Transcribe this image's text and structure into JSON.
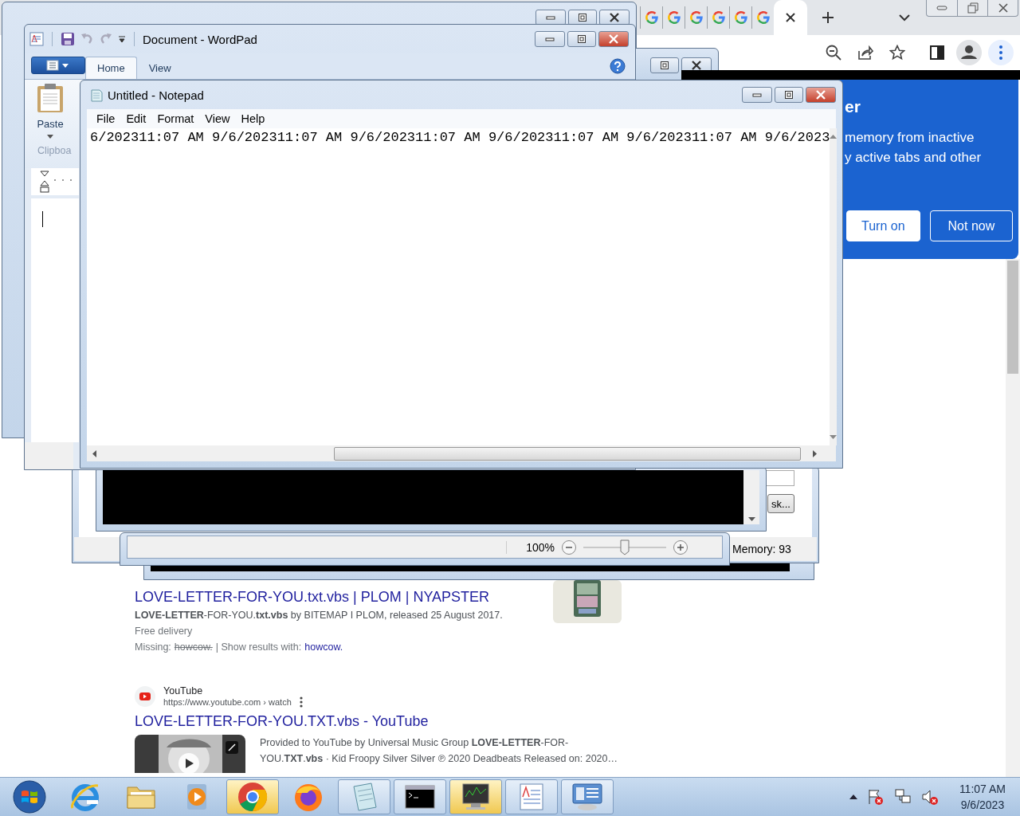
{
  "browser": {
    "tabs": [
      {
        "kind": "google",
        "selected": false
      },
      {
        "kind": "google",
        "selected": false
      },
      {
        "kind": "google",
        "selected": false
      },
      {
        "kind": "google",
        "selected": false
      },
      {
        "kind": "google",
        "selected": false
      },
      {
        "kind": "google",
        "selected": false
      },
      {
        "kind": "blank",
        "selected": true
      }
    ],
    "promo": {
      "title": "er",
      "lines": [
        "memory from inactive",
        "y active tabs and other"
      ],
      "buttons": [
        "Turn on",
        "Not now"
      ]
    },
    "results": [
      {
        "kind": "product",
        "title": "LOVE-LETTER-FOR-YOU.txt.vbs | PLOM | NYAPSTER",
        "snippet": "**LOVE-LETTER**-FOR-YOU.**txt.vbs** by BITEMAP I PLOM, released 25 August 2017.",
        "extra": "Free delivery",
        "missing_label": "Missing:",
        "missing_term": "howcow.",
        "show_label": "| Show results with:",
        "show_link": "howcow."
      },
      {
        "kind": "video",
        "source": "YouTube",
        "url": "https://www.youtube.com › watch",
        "title": "LOVE-LETTER-FOR-YOU.TXT.vbs - YouTube",
        "snippet": "Provided to YouTube by Universal Music Group **LOVE-LETTER**-FOR-YOU.**TXT**.**vbs** · Kid Froopy Silver Silver ℗ 2020 Deadbeats Released on: 2020…"
      }
    ]
  },
  "wordpad": {
    "title": "Document - WordPad",
    "tabs": [
      {
        "label": "Home",
        "selected": true
      },
      {
        "label": "View",
        "selected": false
      }
    ],
    "paste": "Paste",
    "group": "Clipboa"
  },
  "notepad": {
    "title": "Untitled - Notepad",
    "menu": [
      "File",
      "Edit",
      "Format",
      "View",
      "Help"
    ],
    "text": "6/202311:07 AM 9/6/202311:07 AM 9/6/202311:07 AM 9/6/202311:07 AM 9/6/202311:07 AM 9/6/2023"
  },
  "task_window": {
    "button": "sk...",
    "memory": "Memory: 93"
  },
  "zoom_bar": {
    "zoom": "100%",
    "level": 0.5
  },
  "taskbar": {
    "items": [
      {
        "kind": "start",
        "open": false,
        "highlighted": false
      },
      {
        "kind": "ie",
        "open": false,
        "highlighted": false
      },
      {
        "kind": "folder",
        "open": false,
        "highlighted": false
      },
      {
        "kind": "player",
        "open": false,
        "highlighted": false
      },
      {
        "kind": "chrome",
        "open": true,
        "highlighted": true
      },
      {
        "kind": "firefox",
        "open": false,
        "highlighted": false
      },
      {
        "kind": "notepad",
        "open": true,
        "highlighted": false
      },
      {
        "kind": "console",
        "open": true,
        "highlighted": false
      },
      {
        "kind": "monitor",
        "open": true,
        "highlighted": true
      },
      {
        "kind": "wordpad",
        "open": true,
        "highlighted": false
      },
      {
        "kind": "panel",
        "open": true,
        "highlighted": false
      }
    ],
    "clock": {
      "time": "11:07 AM",
      "date": "9/6/2023"
    }
  }
}
